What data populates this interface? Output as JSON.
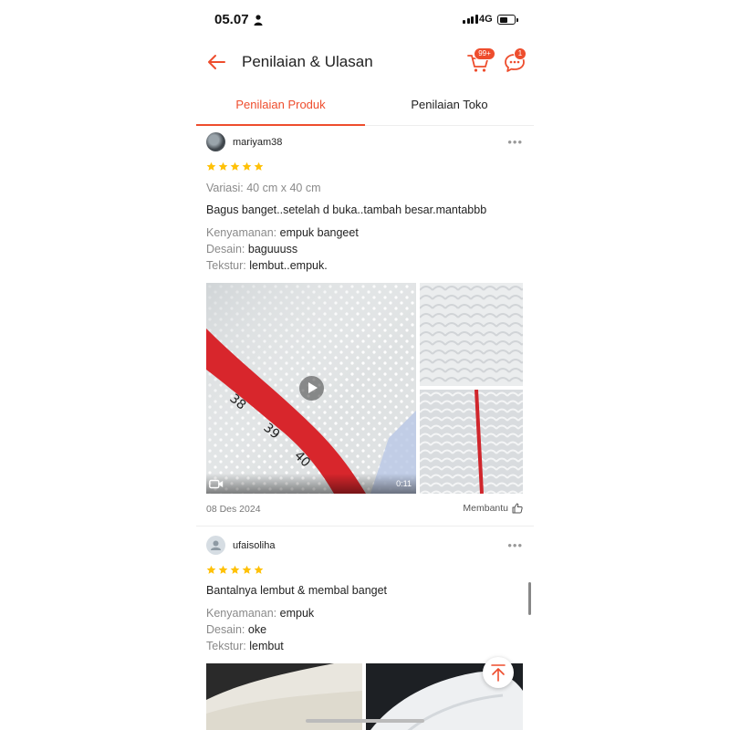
{
  "status_bar": {
    "time": "05.07",
    "network": "4G"
  },
  "header": {
    "title": "Penilaian & Ulasan",
    "cart_badge": "99+",
    "chat_badge": "1"
  },
  "tabs": [
    {
      "label": "Penilaian Produk",
      "active": true
    },
    {
      "label": "Penilaian Toko",
      "active": false
    }
  ],
  "colors": {
    "accent": "#ee4d2d",
    "star": "#ffc107"
  },
  "reviews": [
    {
      "username": "mariyam38",
      "rating": 5,
      "variation": "Variasi: 40 cm x 40 cm",
      "comment": "Bagus banget..setelah d buka..tambah besar.mantabbb",
      "attributes": [
        {
          "label": "Kenyamanan:",
          "value": "empuk bangeet"
        },
        {
          "label": "Desain:",
          "value": "baguuuss"
        },
        {
          "label": "Tekstur:",
          "value": "lembut..empuk."
        }
      ],
      "video_duration": "0:11",
      "date": "08 Des 2024",
      "helpful_label": "Membantu"
    },
    {
      "username": "ufaisoliha",
      "rating": 5,
      "comment": "Bantalnya lembut & membal banget",
      "attributes": [
        {
          "label": "Kenyamanan:",
          "value": "empuk"
        },
        {
          "label": "Desain:",
          "value": "oke"
        },
        {
          "label": "Tekstur:",
          "value": "lembut"
        }
      ]
    }
  ],
  "icons": {
    "back": "arrow-left-icon",
    "cart": "cart-icon",
    "chat": "chat-icon",
    "more": "more-icon",
    "star": "star-icon",
    "play": "play-icon",
    "video": "video-camera-icon",
    "helpful": "thumbs-up-icon",
    "to_top": "arrow-up-icon"
  }
}
